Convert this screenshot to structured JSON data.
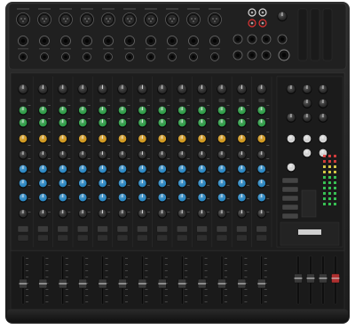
{
  "device": {
    "kind": "analog mixing console",
    "channel_count": 12,
    "stereo_channel_count": 4,
    "colors": {
      "chassis": "#232323",
      "panel": "#1b1b1b",
      "knob_gain": "#2b2b2b",
      "knob_aux": "#2fa84a",
      "knob_eq_mid": "#e0a21c",
      "knob_eq": "#2a8fd0",
      "pan": "#6a6a6a",
      "meter_green": "#3bd15a",
      "meter_yellow": "#e8d84a",
      "meter_red": "#e34040"
    }
  }
}
